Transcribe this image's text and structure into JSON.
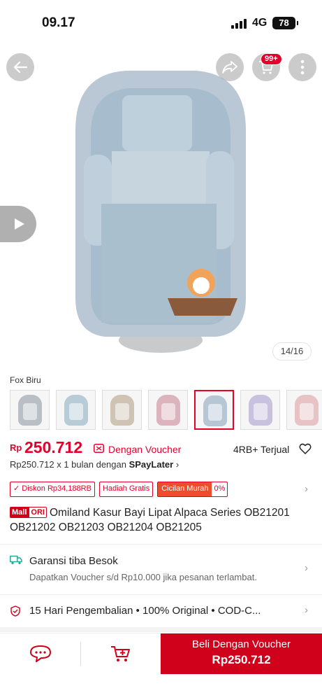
{
  "status_bar": {
    "time": "09.17",
    "network": "4G",
    "battery": "78"
  },
  "image_area": {
    "cart_badge": "99+",
    "image_counter": "14/16"
  },
  "variant": {
    "label": "Fox Biru",
    "thumbnails": [
      {
        "color": "#b9bfc4"
      },
      {
        "color": "#b8ccd8"
      },
      {
        "color": "#cfc3b4"
      },
      {
        "color": "#dcb4bd"
      },
      {
        "color": "#b7c6d4"
      },
      {
        "color": "#c9c2df"
      },
      {
        "color": "#e8c3c6"
      }
    ],
    "selected_index": 4
  },
  "price": {
    "currency": "Rp",
    "value": "250.712",
    "voucher_text": "Dengan Voucher",
    "sold": "4RB+ Terjual"
  },
  "paylater": {
    "prefix": "Rp250.712 x 1 bulan dengan ",
    "brand": "SPayLater",
    "chevron": "›"
  },
  "tags": {
    "discount": "Diskon Rp34,188RB",
    "gift": "Hadiah Gratis",
    "installment_label": "Cicilan Murah",
    "installment_value": "0%"
  },
  "title": {
    "badge_mall": "Mall",
    "badge_ori": "ORI",
    "text": "Omiland Kasur Bayi Lipat Alpaca Series OB21201 OB21202 OB21203 OB21204 OB21205"
  },
  "shipping": {
    "title": "Garansi tiba Besok",
    "subtitle": "Dapatkan Voucher s/d Rp10.000 jika pesanan terlambat."
  },
  "policy": {
    "text": "15 Hari Pengembalian  •  100% Original  •  COD-C..."
  },
  "bottom_bar": {
    "buy_label": "Beli Dengan Voucher",
    "buy_price": "Rp250.712"
  },
  "colors": {
    "accent": "#d0011b",
    "price": "#e4002b"
  },
  "icons": [
    "back-arrow-icon",
    "share-icon",
    "cart-icon",
    "more-vertical-icon",
    "play-icon",
    "voucher-icon",
    "heart-icon",
    "truck-icon",
    "shield-icon",
    "chat-icon",
    "add-to-cart-icon",
    "chevron-right-icon"
  ]
}
